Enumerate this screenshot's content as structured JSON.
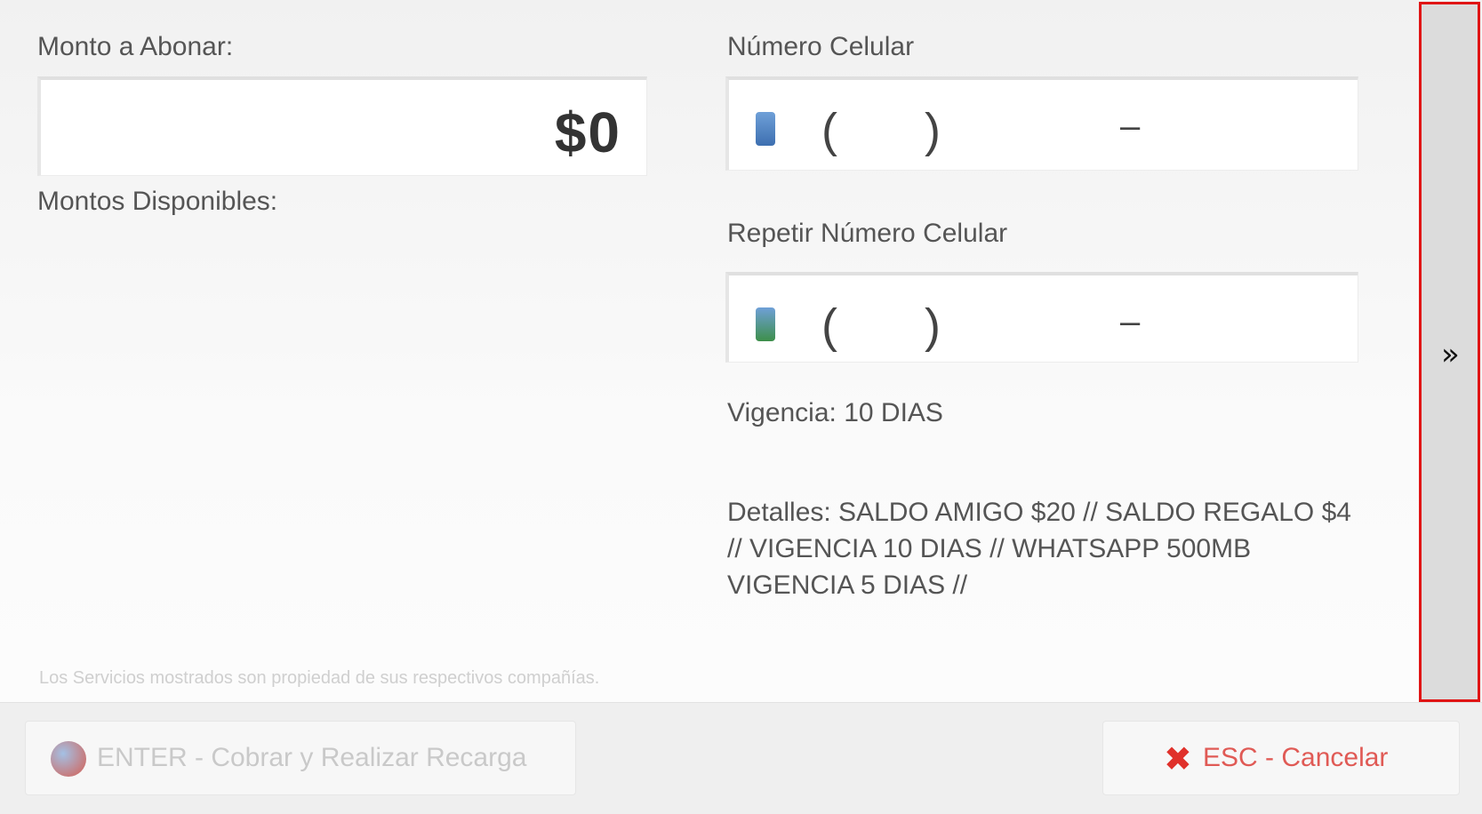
{
  "form": {
    "amount_label": "Monto a Abonar:",
    "amount_value": "$0",
    "available_amounts_label": "Montos Disponibles:",
    "phone_label": "Número Celular",
    "phone_repeat_label": "Repetir Número Celular",
    "phone_mask": {
      "open_paren": "(",
      "close_paren": ")",
      "dash": "–"
    },
    "validity_text": "Vigencia: 10 DIAS",
    "details_text": "Detalles: SALDO AMIGO $20 // SALDO REGALO $4 // VIGENCIA 10 DIAS // WHATSAPP 500MB VIGENCIA 5 DIAS //",
    "footnote": "Los Servicios mostrados son propiedad de sus respectivos compañías."
  },
  "side_panel": {
    "expand_glyph": "»"
  },
  "footer": {
    "charge_label": "ENTER - Cobrar y Realizar Recarga",
    "cancel_label": "ESC - Cancelar",
    "cancel_glyph": "✖"
  },
  "colors": {
    "highlight_border": "#e01515",
    "cancel_accent": "#e0312b"
  }
}
